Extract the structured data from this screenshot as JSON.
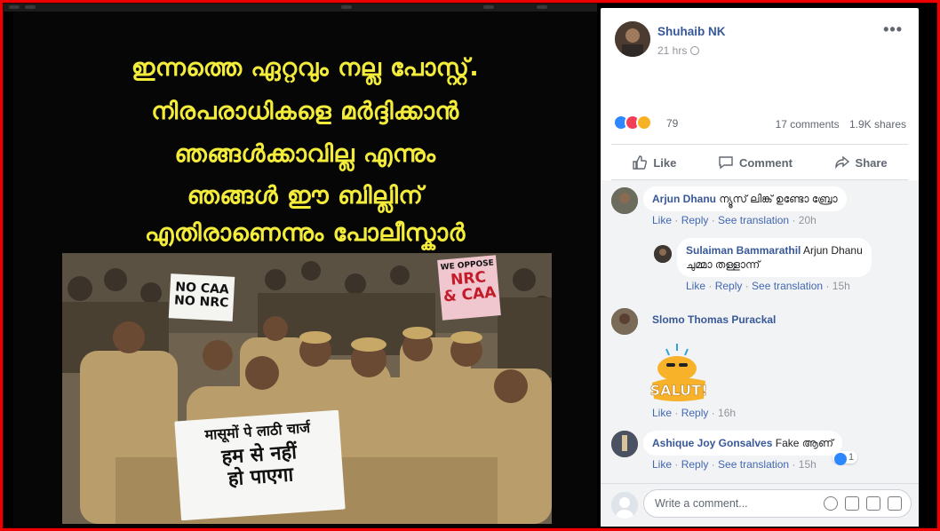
{
  "post_image": {
    "headline_lines": [
      "ഇന്നത്തെ ഏറ്റവും നല്ല പോസ്റ്റ്.",
      "നിരപരാധികളെ മർദ്ദിക്കാൻ",
      "ഞങ്ങൾക്കാവില്ല എന്നും",
      "ഞങ്ങൾ ഈ ബില്ലിന്",
      "എതിരാണെന്നും പോലീസ്കാർ"
    ],
    "sign_left": [
      "NO CAA",
      "NO NRC"
    ],
    "sign_right_small": "WE OPPOSE",
    "sign_right_big": [
      "NRC",
      "& CAA"
    ],
    "sign_hindi": [
      "मासूमों पे लाठी चार्ज",
      "हम से नहीं",
      "हो पाएगा"
    ]
  },
  "post": {
    "author": "Shuhaib NK",
    "time": "21 hrs",
    "more_label": "•••",
    "reaction_count": "79",
    "comments_count": "17 comments",
    "shares_count": "1.9K shares"
  },
  "actions": {
    "like": "Like",
    "comment": "Comment",
    "share": "Share"
  },
  "comments": [
    {
      "name": "Arjun Dhanu",
      "text": "ന്യൂസ് ലിങ്ക് ഉണ്ടോ ബ്രോ",
      "like": "Like",
      "reply": "Reply",
      "translate": "See translation",
      "time": "20h"
    },
    {
      "name": "Sulaiman Bammarathil",
      "text_tag": "Arjun Dhanu",
      "text": "ചുമ്മാ തള്ളാന്ന്",
      "like": "Like",
      "reply": "Reply",
      "translate": "See translation",
      "time": "15h"
    },
    {
      "name": "Slomo Thomas Purackal",
      "sticker_text": "SALUT!",
      "like": "Like",
      "reply": "Reply",
      "time": "16h"
    },
    {
      "name": "Ashique Joy Gonsalves",
      "text": "Fake ആണ്",
      "like": "Like",
      "reply": "Reply",
      "translate": "See translation",
      "time": "15h",
      "likes": "1"
    }
  ],
  "composer": {
    "placeholder": "Write a comment..."
  },
  "separators": {
    "dot": " · "
  },
  "colors": {
    "outer_border": "#ee0000",
    "headline": "#f4ec3a",
    "link": "#385898"
  }
}
